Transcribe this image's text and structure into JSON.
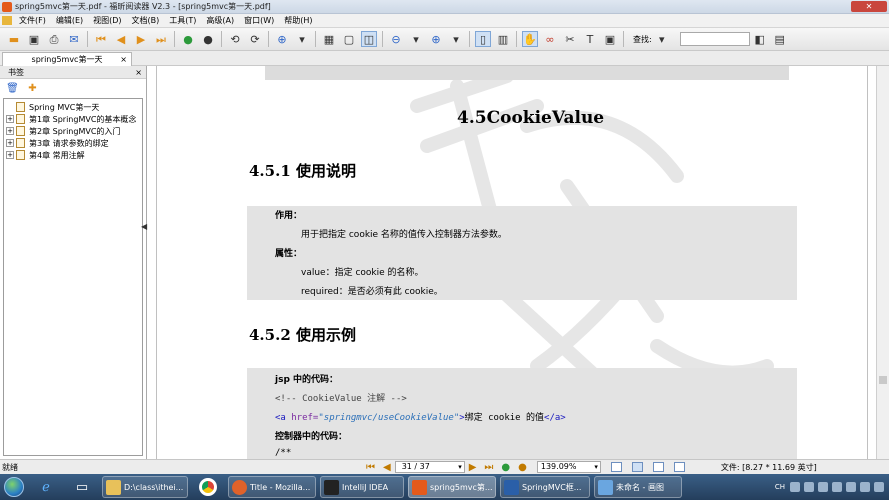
{
  "window": {
    "title": "spring5mvc第一天.pdf - 福昕阅读器 V2.3 - [spring5mvc第一天.pdf]"
  },
  "menu": [
    "文件(F)",
    "编辑(E)",
    "视图(D)",
    "文档(B)",
    "工具(T)",
    "高级(A)",
    "窗口(W)",
    "帮助(H)"
  ],
  "toolbar": {
    "search_label": "查找:"
  },
  "doc_tab": {
    "label": "spring5mvc第一天",
    "close": "×"
  },
  "sidebar": {
    "title": "书签",
    "close": "×",
    "items": [
      {
        "label": "Spring MVC第一天",
        "expander": ""
      },
      {
        "label": "第1章 SpringMVC的基本概念",
        "expander": "+"
      },
      {
        "label": "第2章 SpringMVC的入门",
        "expander": "+"
      },
      {
        "label": "第3章 请求参数的绑定",
        "expander": "+"
      },
      {
        "label": "第4章 常用注解",
        "expander": "+"
      }
    ]
  },
  "document": {
    "section_title": "4.5CookieValue",
    "sub1": "4.5.1  使用说明",
    "sub2": "4.5.2  使用示例",
    "box1": {
      "effect_label": "作用：",
      "effect_text": "用于把指定 cookie 名称的值传入控制器方法参数。",
      "attr_label": "属性：",
      "value_text": "value：指定 cookie 的名称。",
      "required_text": "required：是否必须有此 cookie。"
    },
    "box2": {
      "jsp_label": "jsp 中的代码：",
      "comment": "<!-- CookieValue 注解 -->",
      "tag_open": "<a",
      "attr_name": " href=",
      "attr_value": "\"springmvc/useCookieValue\"",
      "tag_close_open": ">",
      "link_text": "绑定 cookie 的值",
      "tag_end": "</a>",
      "controller_label": "控制器中的代码：",
      "code_start": "/**"
    }
  },
  "status": {
    "text": "就绪",
    "page": "31 / 37",
    "zoom": "139.09%",
    "file_size": "文件: [8.27 * 11.69 英寸]"
  },
  "taskbar": {
    "buttons": [
      {
        "label": "D:\\class\\ithei...",
        "color": "#e8c15a"
      },
      {
        "label": "Title - Mozilla...",
        "color": "#e0622a"
      },
      {
        "label": "IntelliJ IDEA",
        "color": "#222"
      },
      {
        "label": "spring5mvc第...",
        "color": "#e45a1b",
        "active": true
      },
      {
        "label": "SpringMVC框...",
        "color": "#2a5fa8"
      },
      {
        "label": "未命名 - 画图",
        "color": "#6aa6e0"
      }
    ],
    "ime": "CH"
  }
}
